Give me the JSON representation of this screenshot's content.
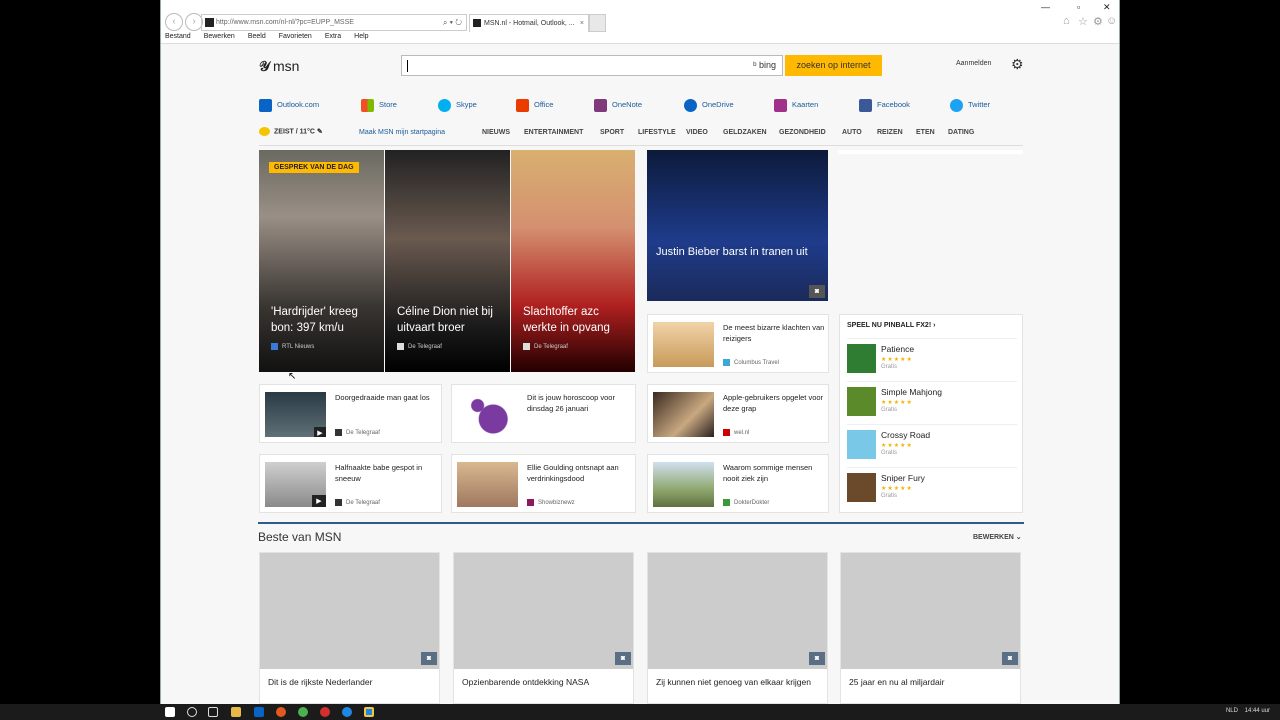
{
  "browser": {
    "url": "http://www.msn.com/nl-nl/?pc=EUPP_MSSE",
    "tab_title": "MSN.nl - Hotmail, Outlook, ...",
    "menu": [
      "Bestand",
      "Bewerken",
      "Beeld",
      "Favorieten",
      "Extra",
      "Help"
    ]
  },
  "header": {
    "logo": "msn",
    "search_brand": "bing",
    "search_button": "zoeken op internet",
    "signin": "Aanmelden"
  },
  "apps": [
    "Outlook.com",
    "Store",
    "Skype",
    "Office",
    "OneNote",
    "OneDrive",
    "Kaarten",
    "Facebook",
    "Twitter"
  ],
  "weather": "ZEIST / 11°C",
  "make_start": "Maak MSN mijn startpagina",
  "categories": [
    "NIEUWS",
    "ENTERTAINMENT",
    "SPORT",
    "LIFESTYLE",
    "VIDEO",
    "GELDZAKEN",
    "GEZONDHEID",
    "AUTO",
    "REIZEN",
    "ETEN",
    "DATING"
  ],
  "hero": {
    "badge": "GESPREK VAN DE DAG",
    "items": [
      {
        "caption": "'Hardrijder' kreeg bon: 397 km/u",
        "source": "RTL Nieuws"
      },
      {
        "caption": "Céline Dion niet bij uitvaart broer",
        "source": "De Telegraaf"
      },
      {
        "caption": "Slachtoffer azc werkte in opvang",
        "source": "De Telegraaf"
      }
    ]
  },
  "feature": {
    "caption": "Justin Bieber barst in tranen uit"
  },
  "cards": [
    {
      "title": "De meest bizarre klachten van reizigers",
      "source": "Columbus Travel"
    },
    {
      "title": "Doorgedraaide man gaat los",
      "source": "De Telegraaf"
    },
    {
      "title": "Dit is jouw horoscoop voor dinsdag 26 januari",
      "source": ""
    },
    {
      "title": "Apple-gebruikers opgelet voor deze grap",
      "source": "wel.nl"
    },
    {
      "title": "Halfnaakte babe gespot in sneeuw",
      "source": "De Telegraaf"
    },
    {
      "title": "Ellie Goulding ontsnapt aan verdrinkingsdood",
      "source": "Showbiznewz"
    },
    {
      "title": "Waarom sommige mensen nooit ziek zijn",
      "source": "DokterDokter"
    }
  ],
  "games": {
    "header": "SPEEL NU PINBALL FX2!",
    "stars": "★★★★★",
    "items": [
      {
        "name": "Patience",
        "price": "Gratis"
      },
      {
        "name": "Simple Mahjong",
        "price": "Gratis"
      },
      {
        "name": "Crossy Road",
        "price": "Gratis"
      },
      {
        "name": "Sniper Fury",
        "price": "Gratis"
      }
    ]
  },
  "beste": {
    "title": "Beste van MSN",
    "edit": "BEWERKEN",
    "items": [
      "Dit is de rijkste Nederlander",
      "Opzienbarende ontdekking NASA",
      "Zij kunnen niet genoeg van elkaar krijgen",
      "25 jaar en nu al miljardair"
    ]
  },
  "taskbar": {
    "lang": "NLD",
    "time": "14:44 uur"
  }
}
